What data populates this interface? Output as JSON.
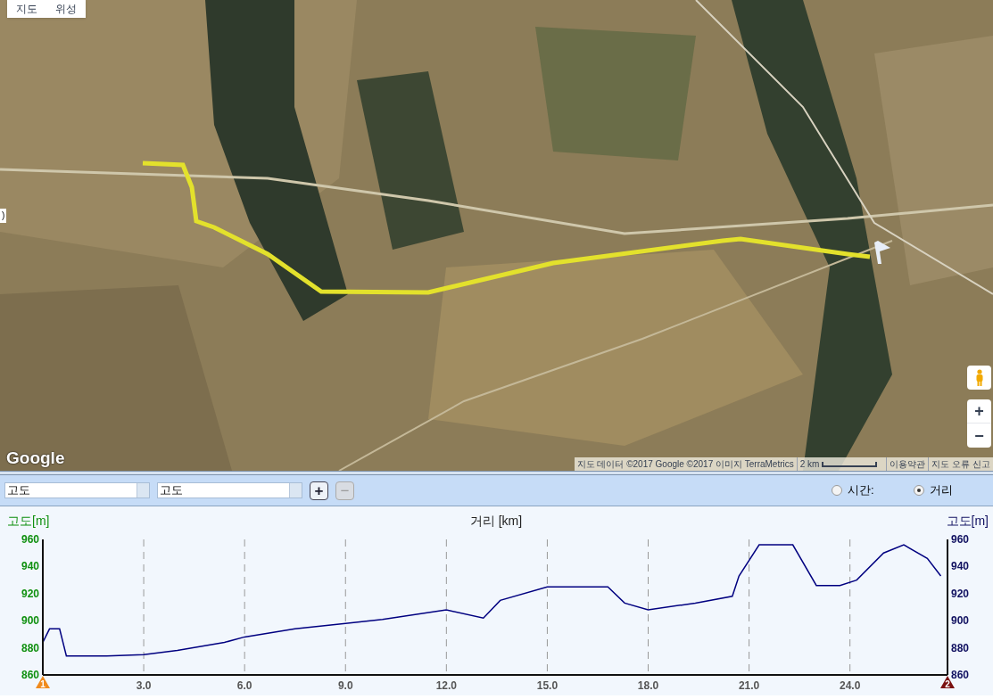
{
  "map": {
    "map_types": [
      {
        "label": "지도"
      },
      {
        "label": "위성"
      }
    ],
    "side_toggle": ")",
    "logo": "Google",
    "attribution": "지도 데이터 ©2017 Google ©2017 이미지 TerraMetrics",
    "scale": "2 km",
    "terms": "이용약관",
    "report": "지도 오류 신고",
    "zoom_in": "+",
    "zoom_out": "−"
  },
  "toolbar": {
    "selects": [
      {
        "value": "고도"
      },
      {
        "value": "고도"
      }
    ],
    "buttons": [
      {
        "label": "+",
        "disabled": false
      },
      {
        "label": "−",
        "disabled": true
      }
    ],
    "radios": [
      {
        "label": "시간:",
        "selected": false
      },
      {
        "label": "거리",
        "selected": true
      }
    ]
  },
  "chart": {
    "left_ticks": [
      "960",
      "940",
      "920",
      "900",
      "880",
      "860"
    ],
    "left_title": "고도[m]",
    "right_title": "고도[m]",
    "start_marker": "1",
    "end_marker": "2",
    "chart_data": {
      "type": "line",
      "grid": true,
      "xlabel": "거리 [km]",
      "xlim": [
        0,
        26.9
      ],
      "ylim": [
        860,
        960
      ],
      "xticks": [
        {
          "value": 3,
          "label": "3.0"
        },
        {
          "value": 6,
          "label": "6.0"
        },
        {
          "value": 9,
          "label": "9.0"
        },
        {
          "value": 12,
          "label": "12.0"
        },
        {
          "value": 15,
          "label": "15.0"
        },
        {
          "value": 18,
          "label": "18.0"
        },
        {
          "value": 21,
          "label": "21.0"
        },
        {
          "value": 24,
          "label": "24.0"
        }
      ],
      "yticks": [
        860,
        880,
        900,
        920,
        940,
        960
      ],
      "x": [
        0,
        0.2,
        0.5,
        0.7,
        1.1,
        1.9,
        3.0,
        4.0,
        5.4,
        6.0,
        7.5,
        9.0,
        10.1,
        12.0,
        13.1,
        13.6,
        15.0,
        16.8,
        17.3,
        18.0,
        19.4,
        20.5,
        20.7,
        21.3,
        22.3,
        23.0,
        23.7,
        24.2,
        25.0,
        25.6,
        26.3,
        26.7
      ],
      "series": [
        {
          "color": "#000080",
          "values": [
            884,
            894,
            894,
            874,
            874,
            874,
            875,
            878,
            884,
            888,
            894,
            898,
            901,
            908,
            902,
            915,
            925,
            925,
            913,
            908,
            913,
            918,
            933,
            956,
            956,
            926,
            926,
            930,
            950,
            956,
            946,
            933
          ]
        }
      ]
    }
  }
}
